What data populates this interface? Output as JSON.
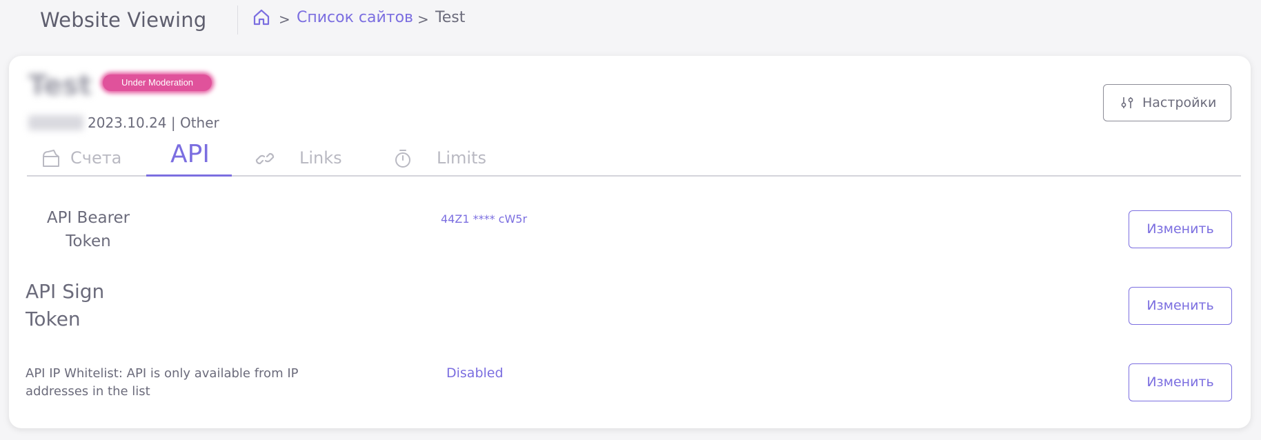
{
  "header": {
    "page_title": "Website Viewing",
    "breadcrumb": {
      "home_icon": "home-icon",
      "items": [
        "Список сайтов",
        "Test"
      ],
      "separator": ">"
    }
  },
  "site": {
    "name": "Test",
    "status_badge": "Under Moderation",
    "meta": "2023.10.24 | Other",
    "settings_button": "Настройки"
  },
  "tabs": [
    {
      "label": "Счета",
      "icon": "wallet-icon",
      "active": false
    },
    {
      "label": "API",
      "active": true
    },
    {
      "label": "Links",
      "icon": "link-icon",
      "active": false
    },
    {
      "label": "Limits",
      "icon": "stopwatch-icon",
      "active": false
    }
  ],
  "api_rows": [
    {
      "label_line1": "API Bearer",
      "label_line2": "Token",
      "value": "44Z1 **** cW5r",
      "button": "Изменить"
    },
    {
      "label_line1": "API Sign",
      "label_line2": "Token",
      "value": "",
      "button": "Изменить"
    },
    {
      "label_line1": "API IP Whitelist: API is only available from IP",
      "label_line2": "addresses in the list",
      "value": "Disabled",
      "button": "Изменить"
    }
  ],
  "colors": {
    "accent": "#7b6ee0",
    "badge": "#e0529b",
    "text": "#6b6b7b",
    "muted": "#b9b9c2"
  }
}
